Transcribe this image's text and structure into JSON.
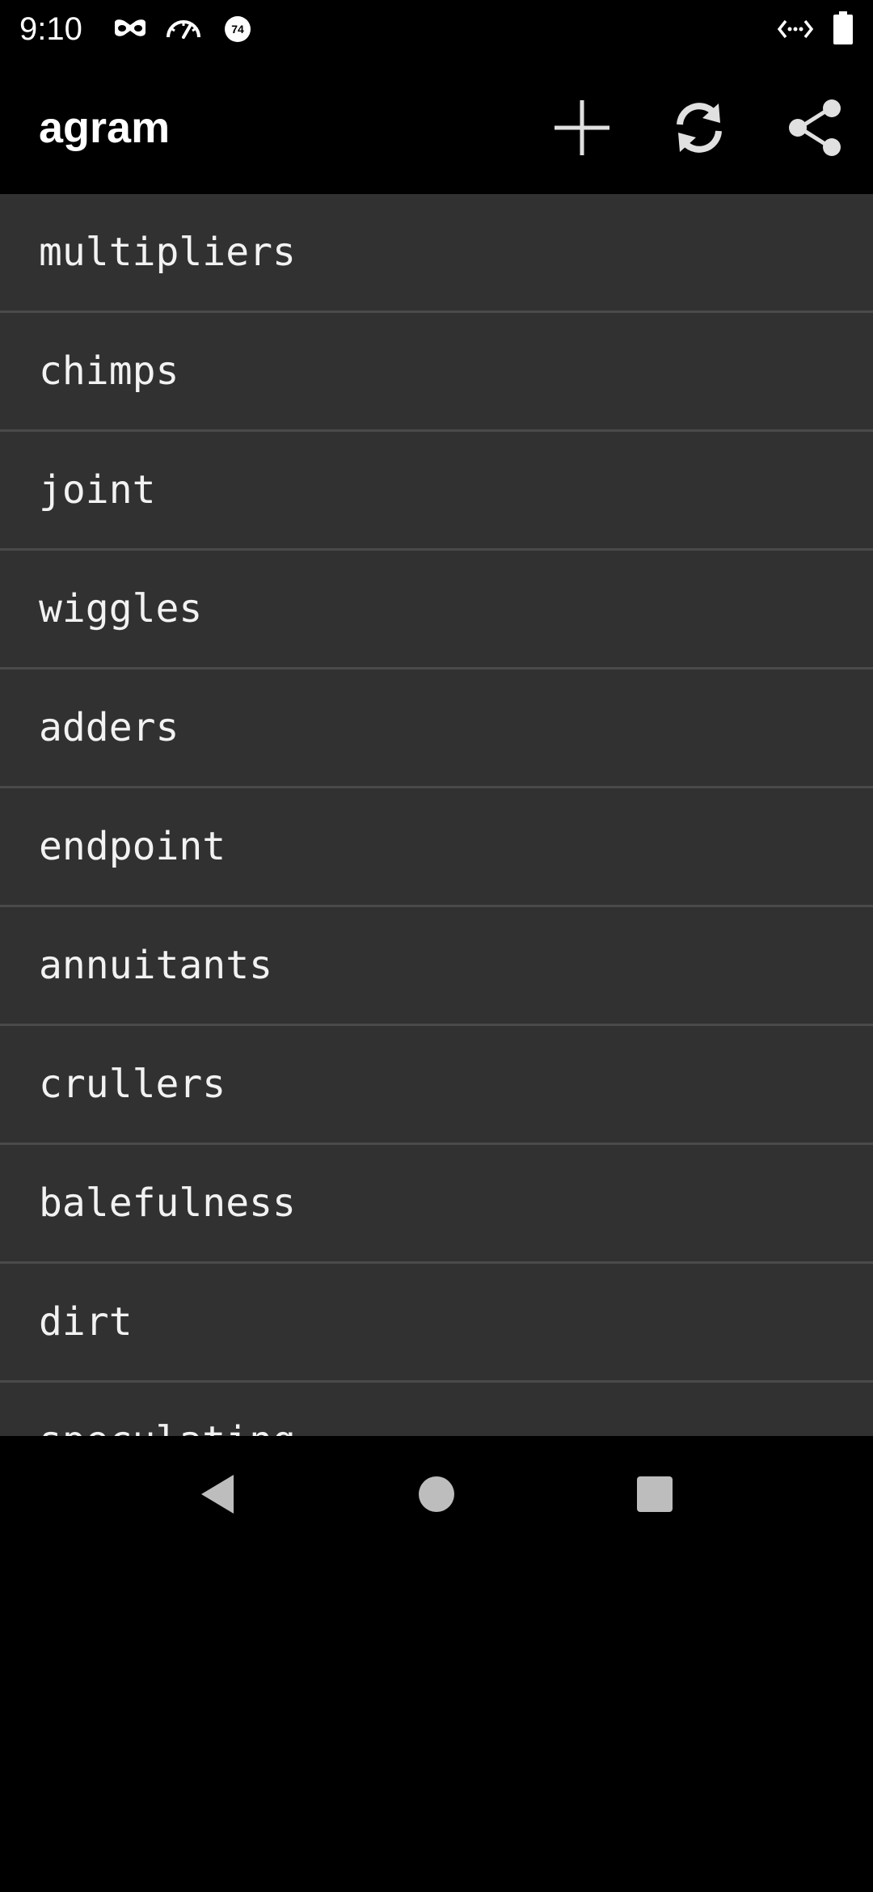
{
  "status_bar": {
    "time": "9:10",
    "icons": [
      "incognito-icon",
      "speedometer-icon",
      "notification-badge-icon",
      "code-icon",
      "battery-icon"
    ],
    "badge_text": "74"
  },
  "toolbar": {
    "title": "agram",
    "actions": [
      "add-icon",
      "refresh-icon",
      "share-icon"
    ]
  },
  "list": {
    "items": [
      "multipliers",
      "chimps",
      "joint",
      "wiggles",
      "adders",
      "endpoint",
      "annuitants",
      "crullers",
      "balefulness",
      "dirt",
      "speculating"
    ]
  },
  "nav": {
    "buttons": [
      "back-icon",
      "home-icon",
      "recents-icon"
    ]
  },
  "colors": {
    "background": "#000000",
    "list_background": "#313131",
    "divider": "#4a4a4a",
    "text": "#ffffff"
  }
}
